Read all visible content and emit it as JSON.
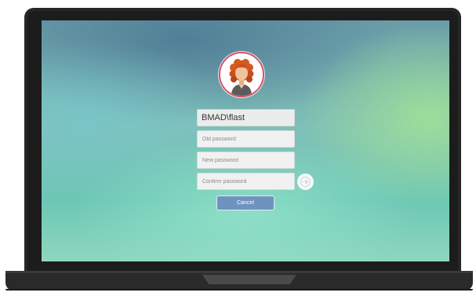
{
  "login": {
    "username": "BMAD\\flast",
    "old_password_placeholder": "Old password",
    "new_password_placeholder": "New password",
    "confirm_password_placeholder": "Confirm password",
    "cancel_label": "Cancel",
    "submit_icon": "arrow-right-icon",
    "avatar_icon": "user-avatar-icon"
  },
  "colors": {
    "cancel_button": "#6f93bf",
    "avatar_ring": "#d8506a",
    "field_background": "#f1f1f1"
  }
}
